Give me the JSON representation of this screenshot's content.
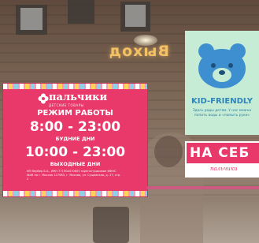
{
  "exit_sign": "Выход",
  "schedule_sign": {
    "brand": "пальчики",
    "brand_tagline": "ДЕТСКИЕ ТОВАРЫ",
    "title": "РЕЖИМ РАБОТЫ",
    "weekday_hours": "8:00 - 23:00",
    "weekday_label": "БУДНИЕ ДНИ",
    "weekend_hours": "10:00 - 23:00",
    "weekend_label": "ВЫХОДНЫЕ ДНИ",
    "legal_text": "ИП Вербер Б.А., ИНН 771904470605 зарегистрирован ИФНС №46 по г. Москва 127083, г. Москва, ул. Сущевская, д. 27, стр. 2",
    "accent_color": "#e8396a"
  },
  "kid_friendly_sign": {
    "title": "KID-FRIENDLY",
    "subtitle": "Здесь рады детям. У нас можно попить воды и «помыть руки»",
    "icon": "bear-icon",
    "accent_color": "#c6ecd5"
  },
  "partial_sign": {
    "text": "НА СЕБ",
    "logo": "пальчики"
  }
}
